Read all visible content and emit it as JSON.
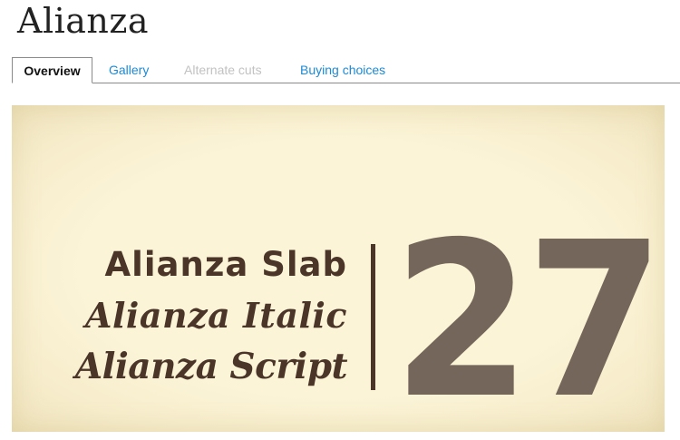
{
  "page": {
    "title": "Alianza"
  },
  "tabs": [
    {
      "label": "Overview",
      "state": "active"
    },
    {
      "label": "Gallery",
      "state": "link"
    },
    {
      "label": "Alternate cuts",
      "state": "disabled"
    },
    {
      "label": "Buying choices",
      "state": "link"
    }
  ],
  "banner": {
    "lines": [
      "Alianza Slab",
      "Alianza Italic",
      "Alianza Script"
    ],
    "number": "27",
    "colors": {
      "background": "#fbf4d7",
      "text": "#4a3528",
      "number": "#74665a"
    }
  },
  "colors": {
    "link": "#1c8ad6",
    "disabled": "#c2c2c2",
    "title": "#222222"
  }
}
